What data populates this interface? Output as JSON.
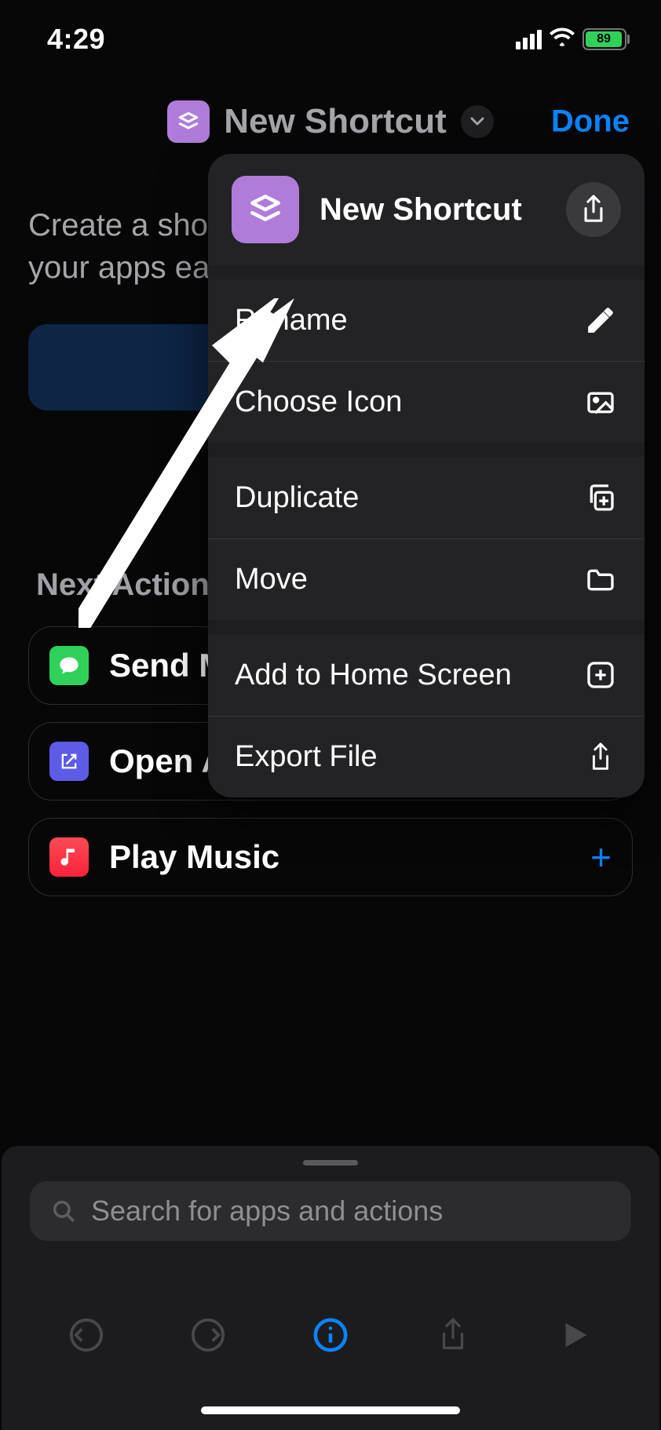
{
  "status": {
    "time": "4:29",
    "battery_percent": "89"
  },
  "nav": {
    "title": "New Shortcut",
    "done": "Done"
  },
  "main": {
    "intro_line1": "Create a shortcut to",
    "intro_line2": "your apps easily.",
    "section_heading": "Next Action Suggestions"
  },
  "suggestions": [
    {
      "label": "Send Message"
    },
    {
      "label": "Open App"
    },
    {
      "label": "Play Music"
    }
  ],
  "context_menu": {
    "title": "New Shortcut",
    "items": [
      {
        "label": "Rename",
        "icon": "pencil"
      },
      {
        "label": "Choose Icon",
        "icon": "photo"
      },
      {
        "label": "Duplicate",
        "icon": "duplicate"
      },
      {
        "label": "Move",
        "icon": "folder"
      },
      {
        "label": "Add to Home Screen",
        "icon": "plus-square"
      },
      {
        "label": "Export File",
        "icon": "export"
      }
    ]
  },
  "search": {
    "placeholder": "Search for apps and actions"
  }
}
